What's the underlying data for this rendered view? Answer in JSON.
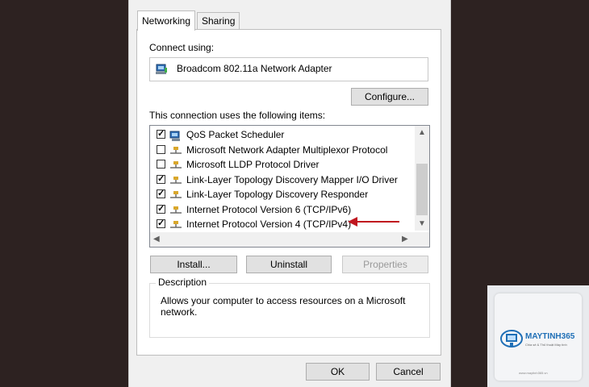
{
  "tabs": [
    {
      "label": "Networking",
      "active": true
    },
    {
      "label": "Sharing",
      "active": false
    }
  ],
  "connect_using": {
    "label": "Connect using:",
    "adapter_name": "Broadcom 802.11a Network Adapter",
    "configure_button": "Configure..."
  },
  "items_section": {
    "label": "This connection uses the following items:",
    "items": [
      {
        "label": "QoS Packet Scheduler",
        "checked": true,
        "icon": "scheduler-icon"
      },
      {
        "label": "Microsoft Network Adapter Multiplexor Protocol",
        "checked": false,
        "icon": "protocol-icon"
      },
      {
        "label": "Microsoft LLDP Protocol Driver",
        "checked": false,
        "icon": "protocol-icon"
      },
      {
        "label": "Link-Layer Topology Discovery Mapper I/O Driver",
        "checked": true,
        "icon": "protocol-icon"
      },
      {
        "label": "Link-Layer Topology Discovery Responder",
        "checked": true,
        "icon": "protocol-icon"
      },
      {
        "label": "Internet Protocol Version 6 (TCP/IPv6)",
        "checked": true,
        "icon": "protocol-icon"
      },
      {
        "label": "Internet Protocol Version 4 (TCP/IPv4)",
        "checked": true,
        "icon": "protocol-icon"
      }
    ]
  },
  "buttons": {
    "install": "Install...",
    "uninstall": "Uninstall",
    "properties": "Properties",
    "ok": "OK",
    "cancel": "Cancel"
  },
  "description": {
    "title": "Description",
    "text": "Allows your computer to access resources on a Microsoft network."
  },
  "watermark": {
    "brand": "MAYTINH365",
    "tagline": "Chia sẻ & Thủ thuật Máy tính",
    "url": "www.maytinh365.vn"
  },
  "colors": {
    "background": "#2d2221",
    "dialog": "#f0f0f0",
    "annotation_arrow": "#c0161f",
    "logo_blue": "#1f6fb6"
  }
}
